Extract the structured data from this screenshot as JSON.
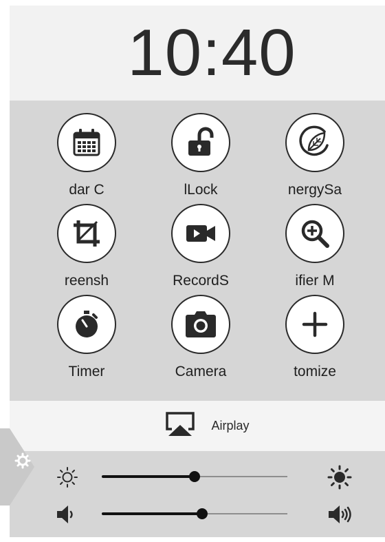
{
  "clock": {
    "time": "10:40"
  },
  "tiles": [
    {
      "label": "dar   C",
      "icon": "calendar-icon"
    },
    {
      "label": "lLock",
      "icon": "lock-icon"
    },
    {
      "label": "nergySa",
      "icon": "energy-saver-icon"
    },
    {
      "label": "reensh",
      "icon": "crop-icon"
    },
    {
      "label": "RecordS",
      "icon": "video-camera-icon"
    },
    {
      "label": "ifier   M",
      "icon": "magnifier-icon"
    },
    {
      "label": "Timer",
      "icon": "timer-icon"
    },
    {
      "label": "Camera",
      "icon": "camera-icon"
    },
    {
      "label": "tomize",
      "icon": "plus-icon"
    }
  ],
  "airplay": {
    "label": "Airplay",
    "icon": "airplay-icon"
  },
  "sliders": {
    "brightness": {
      "value": 0.5,
      "low_icon": "brightness-low-icon",
      "high_icon": "brightness-high-icon"
    },
    "volume": {
      "value": 0.54,
      "low_icon": "volume-low-icon",
      "high_icon": "volume-high-icon"
    }
  },
  "handle": {
    "icon": "gear-icon"
  },
  "colors": {
    "panel_bg": "#d6d6d6",
    "header_bg": "#f2f2f2",
    "icon_dark": "#2a2a2a"
  }
}
